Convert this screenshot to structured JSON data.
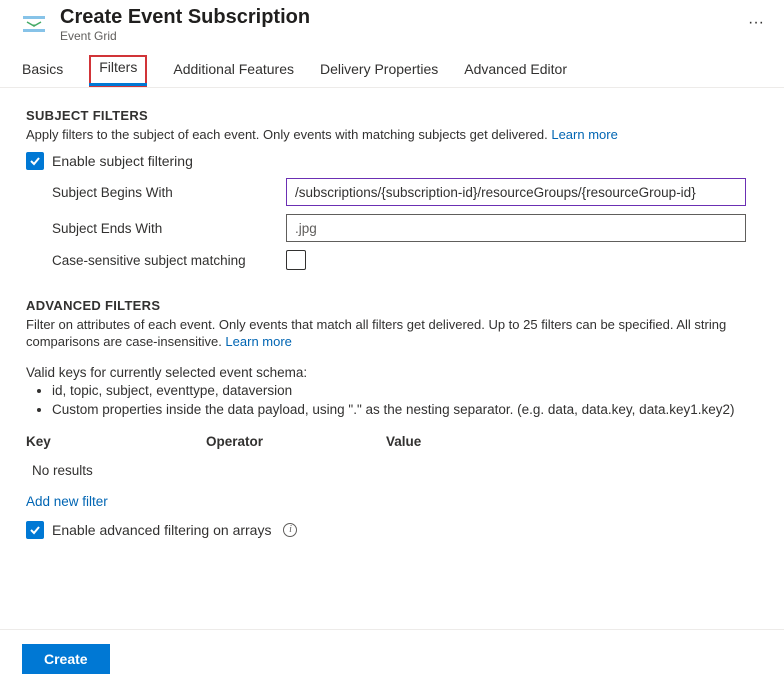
{
  "header": {
    "title": "Create Event Subscription",
    "subtitle": "Event Grid"
  },
  "tabs": {
    "basics": "Basics",
    "filters": "Filters",
    "additional": "Additional Features",
    "delivery": "Delivery Properties",
    "advanced_editor": "Advanced Editor"
  },
  "subject_filters": {
    "heading": "SUBJECT FILTERS",
    "description": "Apply filters to the subject of each event. Only events with matching subjects get delivered. ",
    "learn_more": "Learn more",
    "enable_label": "Enable subject filtering",
    "begins_label": "Subject Begins With",
    "begins_value": "/subscriptions/{subscription-id}/resourceGroups/{resourceGroup-id}",
    "ends_label": "Subject Ends With",
    "ends_placeholder": ".jpg",
    "case_label": "Case-sensitive subject matching"
  },
  "advanced_filters": {
    "heading": "ADVANCED FILTERS",
    "description": "Filter on attributes of each event. Only events that match all filters get delivered. Up to 25 filters can be specified. All string comparisons are case-insensitive. ",
    "learn_more": "Learn more",
    "valid_keys_heading": "Valid keys for currently selected event schema:",
    "bullet1": "id, topic, subject, eventtype, dataversion",
    "bullet2": "Custom properties inside the data payload, using \".\" as the nesting separator. (e.g. data, data.key, data.key1.key2)",
    "col_key": "Key",
    "col_operator": "Operator",
    "col_value": "Value",
    "no_results": "No results",
    "add_new": "Add new filter",
    "enable_arrays_label": "Enable advanced filtering on arrays"
  },
  "footer": {
    "create": "Create"
  }
}
